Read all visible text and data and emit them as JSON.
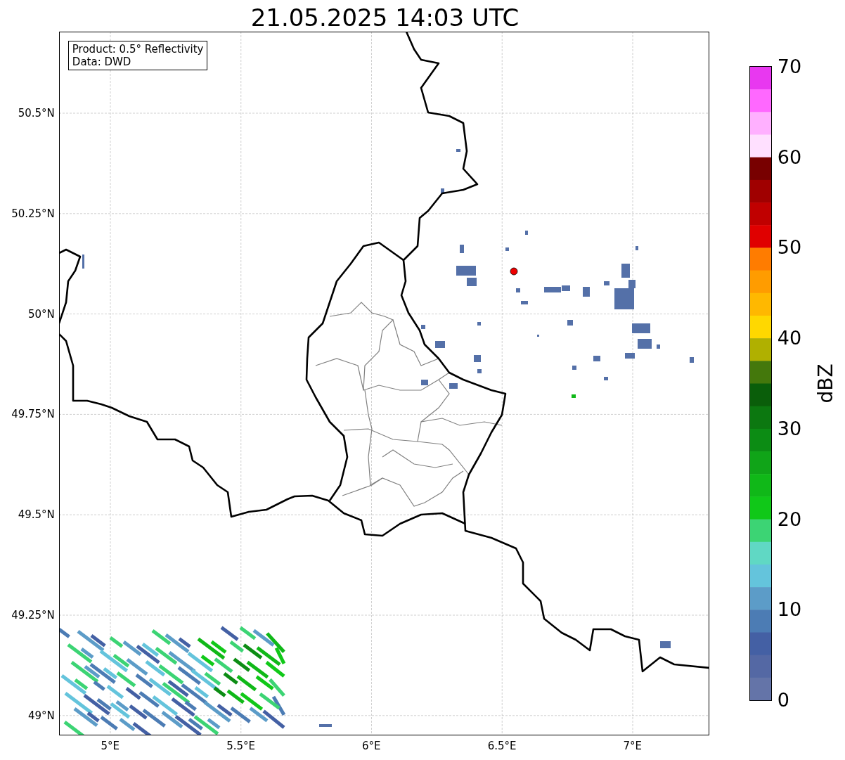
{
  "title": "21.05.2025 14:03 UTC",
  "info": {
    "product": "Product: 0.5° Reflectivity",
    "data": "Data: DWD"
  },
  "lat_ticks": [
    "50.5°N",
    "50.25°N",
    "50°N",
    "49.75°N",
    "49.5°N",
    "49.25°N",
    "49°N"
  ],
  "lon_ticks": [
    "5°E",
    "5.5°E",
    "6°E",
    "6.5°E",
    "7°E"
  ],
  "colorbar": {
    "label": "dBZ",
    "ticks": [
      "70",
      "60",
      "50",
      "40",
      "30",
      "20",
      "10",
      "0"
    ],
    "segments": [
      {
        "color": "#e838f0"
      },
      {
        "color": "#ff68ff"
      },
      {
        "color": "#ffb0ff"
      },
      {
        "color": "#ffe0ff"
      },
      {
        "color": "#780000"
      },
      {
        "color": "#a00000"
      },
      {
        "color": "#c00000"
      },
      {
        "color": "#e00000"
      },
      {
        "color": "#ff7c00"
      },
      {
        "color": "#ff9c00"
      },
      {
        "color": "#ffb800"
      },
      {
        "color": "#ffd800"
      },
      {
        "color": "#b0b000"
      },
      {
        "color": "#44780c"
      },
      {
        "color": "#0a5e0a"
      },
      {
        "color": "#0c7810"
      },
      {
        "color": "#0c8c14"
      },
      {
        "color": "#10a418"
      },
      {
        "color": "#10b818"
      },
      {
        "color": "#10c818"
      },
      {
        "color": "#3cd474"
      },
      {
        "color": "#60d8c4"
      },
      {
        "color": "#64c4dc"
      },
      {
        "color": "#5c9cc8"
      },
      {
        "color": "#4c7cb4"
      },
      {
        "color": "#4460a4"
      },
      {
        "color": "#5468a4"
      },
      {
        "color": "#6474a8"
      }
    ]
  }
}
